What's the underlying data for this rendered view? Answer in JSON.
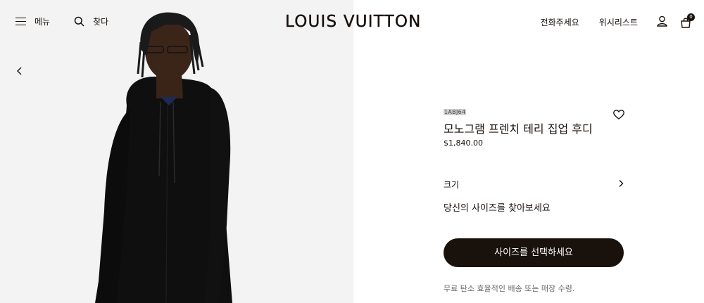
{
  "header": {
    "menu_label": "메뉴",
    "search_label": "찾다",
    "logo": "LOUIS VUITTON",
    "call_label": "전화주세요",
    "wishlist_label": "위시리스트",
    "bag_count": "0"
  },
  "product": {
    "sku": "1ABJ64",
    "title": "모노그램 프렌치 테리 집업 후디",
    "price": "$1,840.00",
    "size_label": "크기",
    "size_guide_link": "당신의 사이즈를 찾아보세요",
    "cta_label": "사이즈를 선택하세요",
    "shipping_note": "무료 탄소 효율적인 배송 또는 매장 수령."
  },
  "colors": {
    "brand_dark": "#19110b",
    "photo_bg": "#f3f3f3"
  },
  "icons": [
    "menu-icon",
    "search-icon",
    "user-icon",
    "bag-icon",
    "heart-icon",
    "chevron-left-icon",
    "chevron-right-icon"
  ]
}
